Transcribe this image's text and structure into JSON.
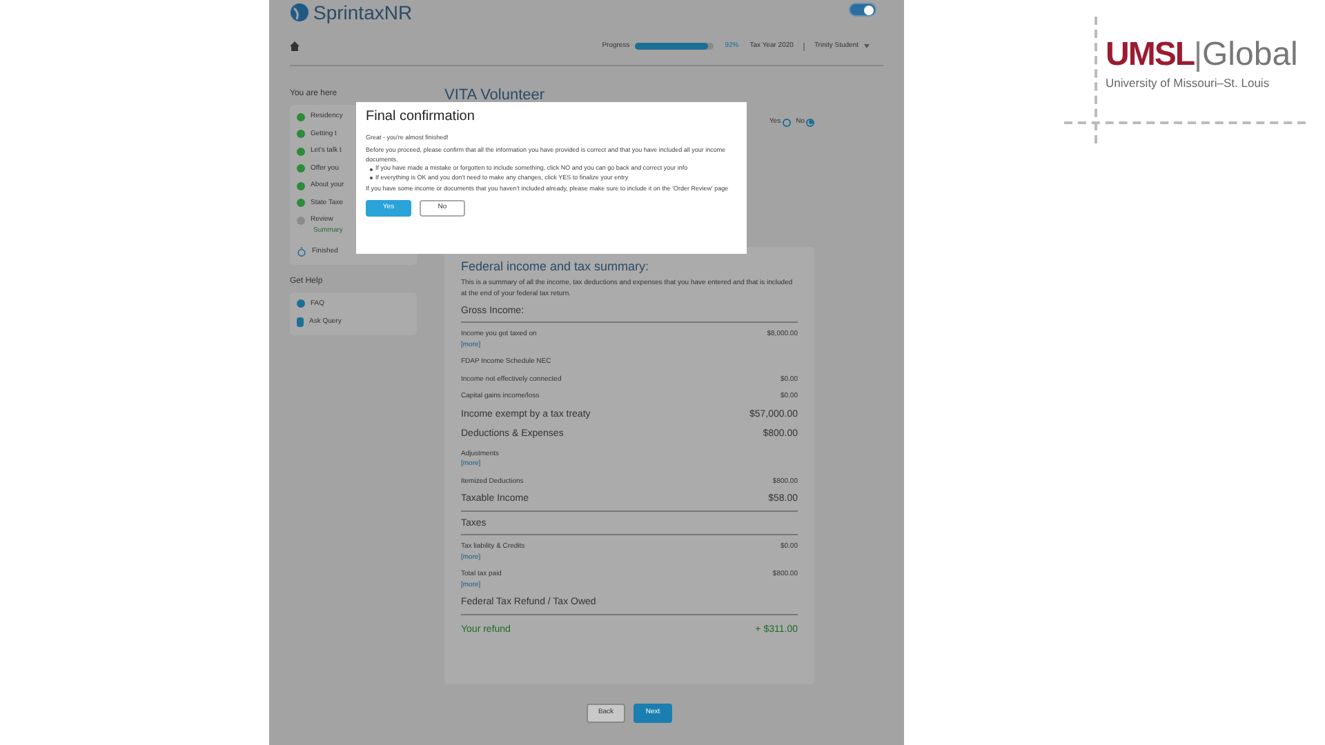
{
  "app": {
    "logo": "SprintaxNR",
    "toggle_on": true
  },
  "nav": {
    "progress_label": "Progress",
    "progress": {
      "level": 0.92
    },
    "progress_text": "92%",
    "tax_year": "Tax Year 2020",
    "user": "Trinity Student"
  },
  "sidebar": {
    "title": "You are here",
    "steps": [
      {
        "label": "Residency",
        "done": true
      },
      {
        "label": "Getting t",
        "done": true
      },
      {
        "label": "Let's talk t",
        "done": true
      },
      {
        "label": "Offer you",
        "done": true
      },
      {
        "label": "About your",
        "done": true
      },
      {
        "label": "State Taxe",
        "done": true
      },
      {
        "label": "Review",
        "done": false,
        "children": [
          {
            "label": "Summary"
          }
        ]
      }
    ],
    "finished": "Finished",
    "help_title": "Get Help",
    "help": [
      {
        "label": "FAQ",
        "kind": "faq"
      },
      {
        "label": "Ask Query",
        "kind": "query"
      }
    ]
  },
  "section": {
    "title": "VITA Volunteer",
    "options": [
      {
        "label": "Yes",
        "selected": false
      },
      {
        "label": "No",
        "selected": true
      }
    ]
  },
  "summary": {
    "title": "Federal income and tax summary:",
    "intro": "This is a summary of all the income, tax deductions and expenses that you have entered and that is included at the end of your federal tax return.",
    "rows": [
      {
        "kind": "heading",
        "label": "Gross Income:"
      },
      {
        "kind": "row",
        "label": "Income you got taxed on",
        "value": "$8,000.00",
        "more": "[more]"
      },
      {
        "kind": "sub",
        "label": "FDAP Income Schedule NEC"
      },
      {
        "kind": "row",
        "label": "Income not effectively connected",
        "value": "$0.00"
      },
      {
        "kind": "row",
        "label": "Capital gains income/loss",
        "value": "$0.00"
      },
      {
        "kind": "major",
        "label": "Income exempt by a tax treaty",
        "value": "$57,000.00"
      },
      {
        "kind": "major",
        "label": "Deductions & Expenses",
        "value": "$800.00"
      },
      {
        "kind": "row",
        "label": "Adjustments",
        "more": "[more]"
      },
      {
        "kind": "row",
        "label": "Itemized Deductions",
        "value": "$800.00"
      },
      {
        "kind": "heading",
        "label": "Taxable Income",
        "value": "$58.00"
      },
      {
        "kind": "heading",
        "label": "Taxes"
      },
      {
        "kind": "row",
        "label": "Tax liability & Credits",
        "value": "$0.00",
        "more": "[more]"
      },
      {
        "kind": "row",
        "label": "Total tax paid",
        "value": "$800.00",
        "more": "[more]"
      },
      {
        "kind": "heading",
        "label": "Federal Tax Refund / Tax Owed"
      },
      {
        "kind": "total",
        "label": "Your refund",
        "value": "+ $311.00"
      }
    ]
  },
  "buttons": [
    {
      "label": "Back",
      "kind": "secondary"
    },
    {
      "label": "Next",
      "kind": "primary"
    }
  ],
  "dialog": {
    "title": "Final confirmation",
    "lead": "Great - you're almost finished!",
    "text": "Before you proceed, please confirm that all the information you have provided is correct and that you have included all your income documents.",
    "bullets": [
      "If you have made a mistake or forgotten to include something, click NO and you can go back and correct your info",
      "If everything is OK and you don't need to make any changes, click YES to finalize your entry"
    ],
    "note": "If you have some income or documents that you haven't included already, please make sure to include it on the 'Order Review' page",
    "buttons": [
      {
        "label": "Yes",
        "kind": "primary"
      },
      {
        "label": "No",
        "kind": "secondary"
      }
    ]
  },
  "brand": {
    "name": "UMSL",
    "sub": "Global",
    "tagline": "University of Missouri–St. Louis"
  }
}
